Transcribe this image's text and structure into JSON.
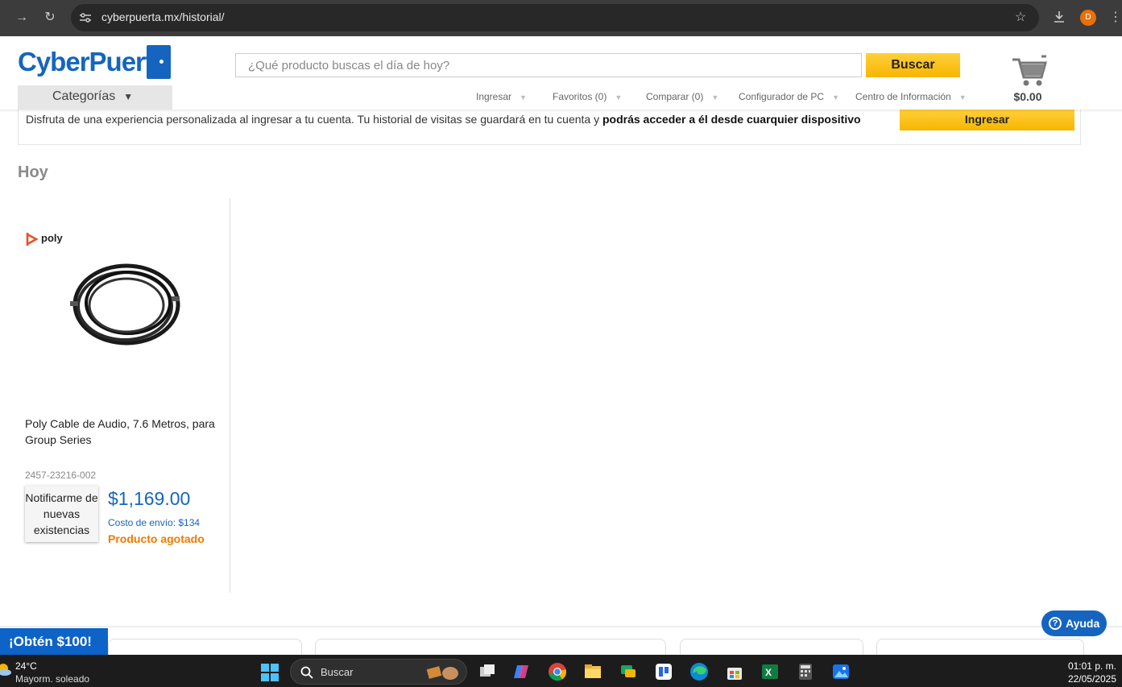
{
  "browser": {
    "url": "cyberpuerta.mx/historial/",
    "profile_initial": "D"
  },
  "header": {
    "logo_text": "CyberPuerta",
    "search_placeholder": "¿Qué producto buscas el día de hoy?",
    "search_button": "Buscar",
    "categories_label": "Categorías",
    "nav": [
      "Ingresar",
      "Favoritos (0)",
      "Comparar (0)",
      "Configurador de PC",
      "Centro de Información"
    ],
    "cart_total": "$0.00"
  },
  "notice": {
    "text": "Disfruta de una experiencia personalizada al ingresar a tu cuenta. Tu historial de visitas se guardará en tu cuenta y ",
    "bold_text": "podrás acceder a él desde cuarquier dispositivo",
    "button": "Ingresar"
  },
  "section_title": "Hoy",
  "product": {
    "brand": "poly",
    "name": "Poly Cable de Audio, 7.6 Metros, para Group Series",
    "sku": "2457-23216-002",
    "notify_button": "Notificarme de nuevas existencias",
    "price": "$1,169.00",
    "shipping": "Costo de envío: $134",
    "stock_status": "Producto agotado"
  },
  "promo_button": "¡Obtén $100!",
  "help_button": "Ayuda",
  "taskbar": {
    "weather_temp": "24°C",
    "weather_desc": "Mayorm. soleado",
    "search_label": "Buscar",
    "time": "01:01 p. m.",
    "date": "22/05/2025"
  },
  "colors": {
    "brand_blue": "#1565c0",
    "button_yellow": "#f7b500",
    "out_of_stock_orange": "#f07a00"
  }
}
